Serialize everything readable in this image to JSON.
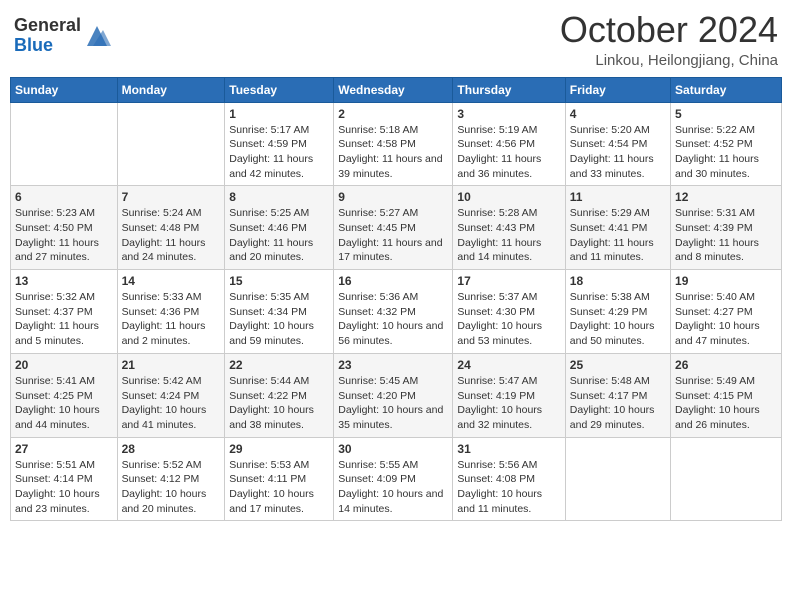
{
  "header": {
    "logo_general": "General",
    "logo_blue": "Blue",
    "month_title": "October 2024",
    "location": "Linkou, Heilongjiang, China"
  },
  "days_of_week": [
    "Sunday",
    "Monday",
    "Tuesday",
    "Wednesday",
    "Thursday",
    "Friday",
    "Saturday"
  ],
  "weeks": [
    [
      {
        "day": null
      },
      {
        "day": null
      },
      {
        "day": 1,
        "sunrise": "Sunrise: 5:17 AM",
        "sunset": "Sunset: 4:59 PM",
        "daylight": "Daylight: 11 hours and 42 minutes."
      },
      {
        "day": 2,
        "sunrise": "Sunrise: 5:18 AM",
        "sunset": "Sunset: 4:58 PM",
        "daylight": "Daylight: 11 hours and 39 minutes."
      },
      {
        "day": 3,
        "sunrise": "Sunrise: 5:19 AM",
        "sunset": "Sunset: 4:56 PM",
        "daylight": "Daylight: 11 hours and 36 minutes."
      },
      {
        "day": 4,
        "sunrise": "Sunrise: 5:20 AM",
        "sunset": "Sunset: 4:54 PM",
        "daylight": "Daylight: 11 hours and 33 minutes."
      },
      {
        "day": 5,
        "sunrise": "Sunrise: 5:22 AM",
        "sunset": "Sunset: 4:52 PM",
        "daylight": "Daylight: 11 hours and 30 minutes."
      }
    ],
    [
      {
        "day": 6,
        "sunrise": "Sunrise: 5:23 AM",
        "sunset": "Sunset: 4:50 PM",
        "daylight": "Daylight: 11 hours and 27 minutes."
      },
      {
        "day": 7,
        "sunrise": "Sunrise: 5:24 AM",
        "sunset": "Sunset: 4:48 PM",
        "daylight": "Daylight: 11 hours and 24 minutes."
      },
      {
        "day": 8,
        "sunrise": "Sunrise: 5:25 AM",
        "sunset": "Sunset: 4:46 PM",
        "daylight": "Daylight: 11 hours and 20 minutes."
      },
      {
        "day": 9,
        "sunrise": "Sunrise: 5:27 AM",
        "sunset": "Sunset: 4:45 PM",
        "daylight": "Daylight: 11 hours and 17 minutes."
      },
      {
        "day": 10,
        "sunrise": "Sunrise: 5:28 AM",
        "sunset": "Sunset: 4:43 PM",
        "daylight": "Daylight: 11 hours and 14 minutes."
      },
      {
        "day": 11,
        "sunrise": "Sunrise: 5:29 AM",
        "sunset": "Sunset: 4:41 PM",
        "daylight": "Daylight: 11 hours and 11 minutes."
      },
      {
        "day": 12,
        "sunrise": "Sunrise: 5:31 AM",
        "sunset": "Sunset: 4:39 PM",
        "daylight": "Daylight: 11 hours and 8 minutes."
      }
    ],
    [
      {
        "day": 13,
        "sunrise": "Sunrise: 5:32 AM",
        "sunset": "Sunset: 4:37 PM",
        "daylight": "Daylight: 11 hours and 5 minutes."
      },
      {
        "day": 14,
        "sunrise": "Sunrise: 5:33 AM",
        "sunset": "Sunset: 4:36 PM",
        "daylight": "Daylight: 11 hours and 2 minutes."
      },
      {
        "day": 15,
        "sunrise": "Sunrise: 5:35 AM",
        "sunset": "Sunset: 4:34 PM",
        "daylight": "Daylight: 10 hours and 59 minutes."
      },
      {
        "day": 16,
        "sunrise": "Sunrise: 5:36 AM",
        "sunset": "Sunset: 4:32 PM",
        "daylight": "Daylight: 10 hours and 56 minutes."
      },
      {
        "day": 17,
        "sunrise": "Sunrise: 5:37 AM",
        "sunset": "Sunset: 4:30 PM",
        "daylight": "Daylight: 10 hours and 53 minutes."
      },
      {
        "day": 18,
        "sunrise": "Sunrise: 5:38 AM",
        "sunset": "Sunset: 4:29 PM",
        "daylight": "Daylight: 10 hours and 50 minutes."
      },
      {
        "day": 19,
        "sunrise": "Sunrise: 5:40 AM",
        "sunset": "Sunset: 4:27 PM",
        "daylight": "Daylight: 10 hours and 47 minutes."
      }
    ],
    [
      {
        "day": 20,
        "sunrise": "Sunrise: 5:41 AM",
        "sunset": "Sunset: 4:25 PM",
        "daylight": "Daylight: 10 hours and 44 minutes."
      },
      {
        "day": 21,
        "sunrise": "Sunrise: 5:42 AM",
        "sunset": "Sunset: 4:24 PM",
        "daylight": "Daylight: 10 hours and 41 minutes."
      },
      {
        "day": 22,
        "sunrise": "Sunrise: 5:44 AM",
        "sunset": "Sunset: 4:22 PM",
        "daylight": "Daylight: 10 hours and 38 minutes."
      },
      {
        "day": 23,
        "sunrise": "Sunrise: 5:45 AM",
        "sunset": "Sunset: 4:20 PM",
        "daylight": "Daylight: 10 hours and 35 minutes."
      },
      {
        "day": 24,
        "sunrise": "Sunrise: 5:47 AM",
        "sunset": "Sunset: 4:19 PM",
        "daylight": "Daylight: 10 hours and 32 minutes."
      },
      {
        "day": 25,
        "sunrise": "Sunrise: 5:48 AM",
        "sunset": "Sunset: 4:17 PM",
        "daylight": "Daylight: 10 hours and 29 minutes."
      },
      {
        "day": 26,
        "sunrise": "Sunrise: 5:49 AM",
        "sunset": "Sunset: 4:15 PM",
        "daylight": "Daylight: 10 hours and 26 minutes."
      }
    ],
    [
      {
        "day": 27,
        "sunrise": "Sunrise: 5:51 AM",
        "sunset": "Sunset: 4:14 PM",
        "daylight": "Daylight: 10 hours and 23 minutes."
      },
      {
        "day": 28,
        "sunrise": "Sunrise: 5:52 AM",
        "sunset": "Sunset: 4:12 PM",
        "daylight": "Daylight: 10 hours and 20 minutes."
      },
      {
        "day": 29,
        "sunrise": "Sunrise: 5:53 AM",
        "sunset": "Sunset: 4:11 PM",
        "daylight": "Daylight: 10 hours and 17 minutes."
      },
      {
        "day": 30,
        "sunrise": "Sunrise: 5:55 AM",
        "sunset": "Sunset: 4:09 PM",
        "daylight": "Daylight: 10 hours and 14 minutes."
      },
      {
        "day": 31,
        "sunrise": "Sunrise: 5:56 AM",
        "sunset": "Sunset: 4:08 PM",
        "daylight": "Daylight: 10 hours and 11 minutes."
      },
      {
        "day": null
      },
      {
        "day": null
      }
    ]
  ]
}
